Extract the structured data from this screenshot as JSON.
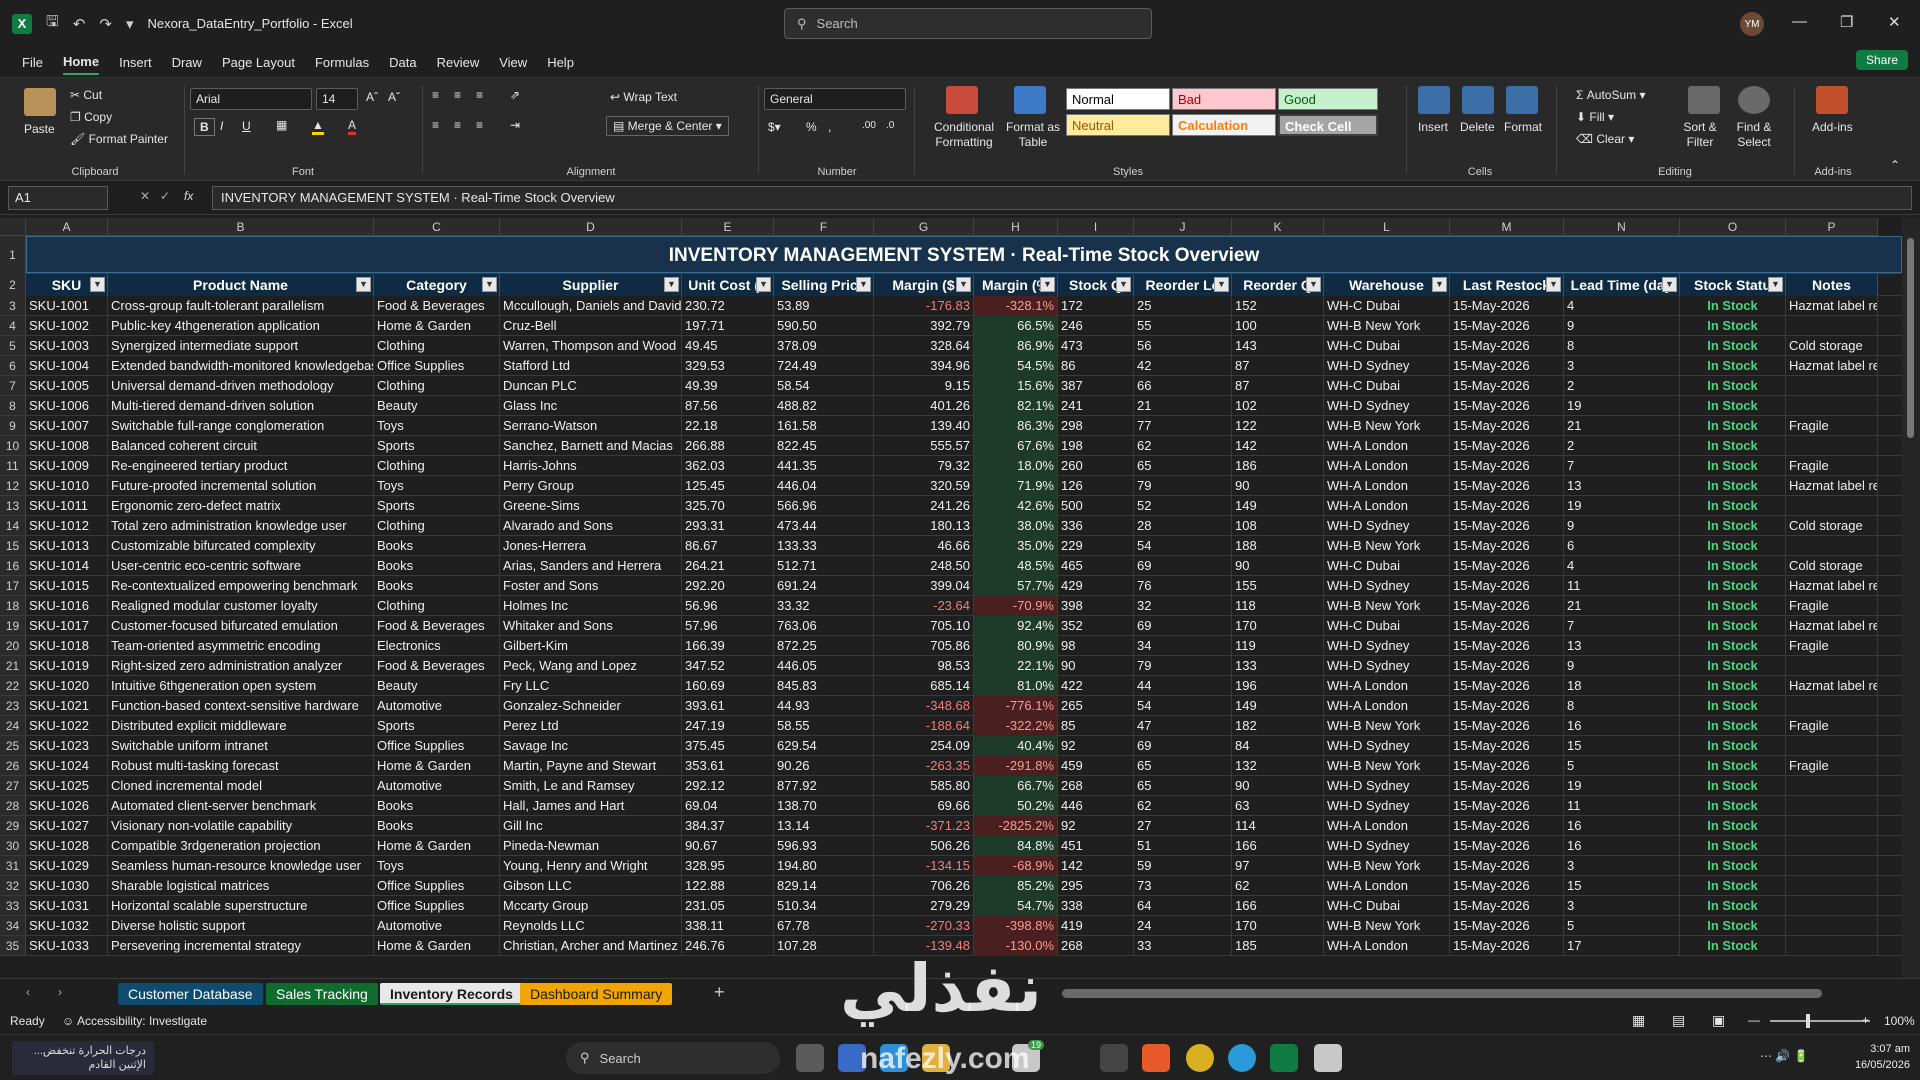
{
  "window": {
    "title": "Nexora_DataEntry_Portfolio - Excel",
    "search_placeholder": "Search",
    "avatar": "YM"
  },
  "menu": {
    "items": [
      "File",
      "Home",
      "Insert",
      "Draw",
      "Page Layout",
      "Formulas",
      "Data",
      "Review",
      "View",
      "Help"
    ],
    "active": "Home",
    "share": "Share"
  },
  "ribbon": {
    "clipboard": {
      "label": "Clipboard",
      "paste": "Paste",
      "cut": "Cut",
      "copy": "Copy",
      "format_painter": "Format Painter"
    },
    "font": {
      "label": "Font",
      "name": "Arial",
      "size": "14"
    },
    "alignment": {
      "label": "Alignment",
      "wrap": "Wrap Text",
      "merge": "Merge & Center"
    },
    "number": {
      "label": "Number",
      "format": "General"
    },
    "styles": {
      "label": "Styles",
      "conditional": "Conditional Formatting",
      "format_table": "Format as Table",
      "normal": "Normal",
      "bad": "Bad",
      "good": "Good",
      "neutral": "Neutral",
      "calculation": "Calculation",
      "check": "Check Cell"
    },
    "cells": {
      "label": "Cells",
      "insert": "Insert",
      "delete": "Delete",
      "format": "Format"
    },
    "editing": {
      "label": "Editing",
      "autosum": "AutoSum",
      "fill": "Fill",
      "clear": "Clear",
      "sort": "Sort & Filter",
      "find": "Find & Select"
    },
    "addins": {
      "label": "Add-ins",
      "btn": "Add-ins"
    }
  },
  "formula_bar": {
    "name_box": "A1",
    "content": "INVENTORY MANAGEMENT SYSTEM  ·  Real-Time Stock Overview"
  },
  "sheet": {
    "columns": [
      "A",
      "B",
      "C",
      "D",
      "E",
      "F",
      "G",
      "H",
      "I",
      "J",
      "K",
      "L",
      "M",
      "N",
      "O",
      "P"
    ],
    "title": "INVENTORY MANAGEMENT SYSTEM  ·  Real-Time Stock Overview",
    "headers": [
      "SKU",
      "Product Name",
      "Category",
      "Supplier",
      "Unit Cost ($",
      "Selling Price",
      "Margin ($",
      "Margin (%",
      "Stock Q",
      "Reorder Le",
      "Reorder Q",
      "Warehouse",
      "Last Restock",
      "Lead Time (day",
      "Stock Statu",
      "Notes"
    ],
    "rows": [
      [
        "SKU-1001",
        "Cross-group fault-tolerant parallelism",
        "Food & Beverages",
        "Mccullough, Daniels and David",
        "230.72",
        "53.89",
        "-176.83",
        "-328.1%",
        "172",
        "25",
        "152",
        "WH-C Dubai",
        "15-May-2026",
        "4",
        "In Stock",
        "Hazmat label requir"
      ],
      [
        "SKU-1002",
        "Public-key 4thgeneration application",
        "Home & Garden",
        "Cruz-Bell",
        "197.71",
        "590.50",
        "392.79",
        "66.5%",
        "246",
        "55",
        "100",
        "WH-B New York",
        "15-May-2026",
        "9",
        "In Stock",
        ""
      ],
      [
        "SKU-1003",
        "Synergized intermediate support",
        "Clothing",
        "Warren, Thompson and Wood",
        "49.45",
        "378.09",
        "328.64",
        "86.9%",
        "473",
        "56",
        "143",
        "WH-C Dubai",
        "15-May-2026",
        "8",
        "In Stock",
        "Cold storage"
      ],
      [
        "SKU-1004",
        "Extended bandwidth-monitored knowledgebas",
        "Office Supplies",
        "Stafford Ltd",
        "329.53",
        "724.49",
        "394.96",
        "54.5%",
        "86",
        "42",
        "87",
        "WH-D Sydney",
        "15-May-2026",
        "3",
        "In Stock",
        "Hazmat label requir"
      ],
      [
        "SKU-1005",
        "Universal demand-driven methodology",
        "Clothing",
        "Duncan PLC",
        "49.39",
        "58.54",
        "9.15",
        "15.6%",
        "387",
        "66",
        "87",
        "WH-C Dubai",
        "15-May-2026",
        "2",
        "In Stock",
        ""
      ],
      [
        "SKU-1006",
        "Multi-tiered demand-driven solution",
        "Beauty",
        "Glass Inc",
        "87.56",
        "488.82",
        "401.26",
        "82.1%",
        "241",
        "21",
        "102",
        "WH-D Sydney",
        "15-May-2026",
        "19",
        "In Stock",
        ""
      ],
      [
        "SKU-1007",
        "Switchable full-range conglomeration",
        "Toys",
        "Serrano-Watson",
        "22.18",
        "161.58",
        "139.40",
        "86.3%",
        "298",
        "77",
        "122",
        "WH-B New York",
        "15-May-2026",
        "21",
        "In Stock",
        "Fragile"
      ],
      [
        "SKU-1008",
        "Balanced coherent circuit",
        "Sports",
        "Sanchez, Barnett and Macias",
        "266.88",
        "822.45",
        "555.57",
        "67.6%",
        "198",
        "62",
        "142",
        "WH-A London",
        "15-May-2026",
        "2",
        "In Stock",
        ""
      ],
      [
        "SKU-1009",
        "Re-engineered tertiary product",
        "Clothing",
        "Harris-Johns",
        "362.03",
        "441.35",
        "79.32",
        "18.0%",
        "260",
        "65",
        "186",
        "WH-A London",
        "15-May-2026",
        "7",
        "In Stock",
        "Fragile"
      ],
      [
        "SKU-1010",
        "Future-proofed incremental solution",
        "Toys",
        "Perry Group",
        "125.45",
        "446.04",
        "320.59",
        "71.9%",
        "126",
        "79",
        "90",
        "WH-A London",
        "15-May-2026",
        "13",
        "In Stock",
        "Hazmat label requir"
      ],
      [
        "SKU-1011",
        "Ergonomic zero-defect matrix",
        "Sports",
        "Greene-Sims",
        "325.70",
        "566.96",
        "241.26",
        "42.6%",
        "500",
        "52",
        "149",
        "WH-A London",
        "15-May-2026",
        "19",
        "In Stock",
        ""
      ],
      [
        "SKU-1012",
        "Total zero administration knowledge user",
        "Clothing",
        "Alvarado and Sons",
        "293.31",
        "473.44",
        "180.13",
        "38.0%",
        "336",
        "28",
        "108",
        "WH-D Sydney",
        "15-May-2026",
        "9",
        "In Stock",
        "Cold storage"
      ],
      [
        "SKU-1013",
        "Customizable bifurcated complexity",
        "Books",
        "Jones-Herrera",
        "86.67",
        "133.33",
        "46.66",
        "35.0%",
        "229",
        "54",
        "188",
        "WH-B New York",
        "15-May-2026",
        "6",
        "In Stock",
        ""
      ],
      [
        "SKU-1014",
        "User-centric eco-centric software",
        "Books",
        "Arias, Sanders and Herrera",
        "264.21",
        "512.71",
        "248.50",
        "48.5%",
        "465",
        "69",
        "90",
        "WH-C Dubai",
        "15-May-2026",
        "4",
        "In Stock",
        "Cold storage"
      ],
      [
        "SKU-1015",
        "Re-contextualized empowering benchmark",
        "Books",
        "Foster and Sons",
        "292.20",
        "691.24",
        "399.04",
        "57.7%",
        "429",
        "76",
        "155",
        "WH-D Sydney",
        "15-May-2026",
        "11",
        "In Stock",
        "Hazmat label requir"
      ],
      [
        "SKU-1016",
        "Realigned modular customer loyalty",
        "Clothing",
        "Holmes Inc",
        "56.96",
        "33.32",
        "-23.64",
        "-70.9%",
        "398",
        "32",
        "118",
        "WH-B New York",
        "15-May-2026",
        "21",
        "In Stock",
        "Fragile"
      ],
      [
        "SKU-1017",
        "Customer-focused bifurcated emulation",
        "Food & Beverages",
        "Whitaker and Sons",
        "57.96",
        "763.06",
        "705.10",
        "92.4%",
        "352",
        "69",
        "170",
        "WH-C Dubai",
        "15-May-2026",
        "7",
        "In Stock",
        "Hazmat label requir"
      ],
      [
        "SKU-1018",
        "Team-oriented asymmetric encoding",
        "Electronics",
        "Gilbert-Kim",
        "166.39",
        "872.25",
        "705.86",
        "80.9%",
        "98",
        "34",
        "119",
        "WH-D Sydney",
        "15-May-2026",
        "13",
        "In Stock",
        "Fragile"
      ],
      [
        "SKU-1019",
        "Right-sized zero administration analyzer",
        "Food & Beverages",
        "Peck, Wang and Lopez",
        "347.52",
        "446.05",
        "98.53",
        "22.1%",
        "90",
        "79",
        "133",
        "WH-D Sydney",
        "15-May-2026",
        "9",
        "In Stock",
        ""
      ],
      [
        "SKU-1020",
        "Intuitive 6thgeneration open system",
        "Beauty",
        "Fry LLC",
        "160.69",
        "845.83",
        "685.14",
        "81.0%",
        "422",
        "44",
        "196",
        "WH-A London",
        "15-May-2026",
        "18",
        "In Stock",
        "Hazmat label requir"
      ],
      [
        "SKU-1021",
        "Function-based context-sensitive hardware",
        "Automotive",
        "Gonzalez-Schneider",
        "393.61",
        "44.93",
        "-348.68",
        "-776.1%",
        "265",
        "54",
        "149",
        "WH-A London",
        "15-May-2026",
        "8",
        "In Stock",
        ""
      ],
      [
        "SKU-1022",
        "Distributed explicit middleware",
        "Sports",
        "Perez Ltd",
        "247.19",
        "58.55",
        "-188.64",
        "-322.2%",
        "85",
        "47",
        "182",
        "WH-B New York",
        "15-May-2026",
        "16",
        "In Stock",
        "Fragile"
      ],
      [
        "SKU-1023",
        "Switchable uniform intranet",
        "Office Supplies",
        "Savage Inc",
        "375.45",
        "629.54",
        "254.09",
        "40.4%",
        "92",
        "69",
        "84",
        "WH-D Sydney",
        "15-May-2026",
        "15",
        "In Stock",
        ""
      ],
      [
        "SKU-1024",
        "Robust multi-tasking forecast",
        "Home & Garden",
        "Martin, Payne and Stewart",
        "353.61",
        "90.26",
        "-263.35",
        "-291.8%",
        "459",
        "65",
        "132",
        "WH-B New York",
        "15-May-2026",
        "5",
        "In Stock",
        "Fragile"
      ],
      [
        "SKU-1025",
        "Cloned incremental model",
        "Automotive",
        "Smith, Le and Ramsey",
        "292.12",
        "877.92",
        "585.80",
        "66.7%",
        "268",
        "65",
        "90",
        "WH-D Sydney",
        "15-May-2026",
        "19",
        "In Stock",
        ""
      ],
      [
        "SKU-1026",
        "Automated client-server benchmark",
        "Books",
        "Hall, James and Hart",
        "69.04",
        "138.70",
        "69.66",
        "50.2%",
        "446",
        "62",
        "63",
        "WH-D Sydney",
        "15-May-2026",
        "11",
        "In Stock",
        ""
      ],
      [
        "SKU-1027",
        "Visionary non-volatile capability",
        "Books",
        "Gill Inc",
        "384.37",
        "13.14",
        "-371.23",
        "-2825.2%",
        "92",
        "27",
        "114",
        "WH-A London",
        "15-May-2026",
        "16",
        "In Stock",
        ""
      ],
      [
        "SKU-1028",
        "Compatible 3rdgeneration projection",
        "Home & Garden",
        "Pineda-Newman",
        "90.67",
        "596.93",
        "506.26",
        "84.8%",
        "451",
        "51",
        "166",
        "WH-D Sydney",
        "15-May-2026",
        "16",
        "In Stock",
        ""
      ],
      [
        "SKU-1029",
        "Seamless human-resource knowledge user",
        "Toys",
        "Young, Henry and Wright",
        "328.95",
        "194.80",
        "-134.15",
        "-68.9%",
        "142",
        "59",
        "97",
        "WH-B New York",
        "15-May-2026",
        "3",
        "In Stock",
        ""
      ],
      [
        "SKU-1030",
        "Sharable logistical matrices",
        "Office Supplies",
        "Gibson LLC",
        "122.88",
        "829.14",
        "706.26",
        "85.2%",
        "295",
        "73",
        "62",
        "WH-A London",
        "15-May-2026",
        "15",
        "In Stock",
        ""
      ],
      [
        "SKU-1031",
        "Horizontal scalable superstructure",
        "Office Supplies",
        "Mccarty Group",
        "231.05",
        "510.34",
        "279.29",
        "54.7%",
        "338",
        "64",
        "166",
        "WH-C Dubai",
        "15-May-2026",
        "3",
        "In Stock",
        ""
      ],
      [
        "SKU-1032",
        "Diverse holistic support",
        "Automotive",
        "Reynolds LLC",
        "338.11",
        "67.78",
        "-270.33",
        "-398.8%",
        "419",
        "24",
        "170",
        "WH-B New York",
        "15-May-2026",
        "5",
        "In Stock",
        ""
      ],
      [
        "SKU-1033",
        "Persevering incremental strategy",
        "Home & Garden",
        "Christian, Archer and Martinez",
        "246.76",
        "107.28",
        "-139.48",
        "-130.0%",
        "268",
        "33",
        "185",
        "WH-A London",
        "15-May-2026",
        "17",
        "In Stock",
        ""
      ]
    ]
  },
  "tabs": [
    {
      "label": "Customer Database",
      "color": "#0e4b6e",
      "text": "#ffffff"
    },
    {
      "label": "Sales Tracking",
      "color": "#0f6b2e",
      "text": "#ffffff"
    },
    {
      "label": "Inventory Records",
      "color": "#e8e8e8",
      "text": "#1a1a1a"
    },
    {
      "label": "Dashboard Summary",
      "color": "#f2a500",
      "text": "#1a1a1a"
    }
  ],
  "status": {
    "ready": "Ready",
    "accessibility": "Accessibility: Investigate",
    "zoom": "100%"
  },
  "taskbar": {
    "weather": "درجات الحرارة تنخفض... الإثنين القادم",
    "search": "Search",
    "time": "3:07 am",
    "date": "16/05/2026",
    "badge": "19"
  },
  "watermark": {
    "arabic": "نفذلي",
    "latin": "nafezly.com"
  }
}
